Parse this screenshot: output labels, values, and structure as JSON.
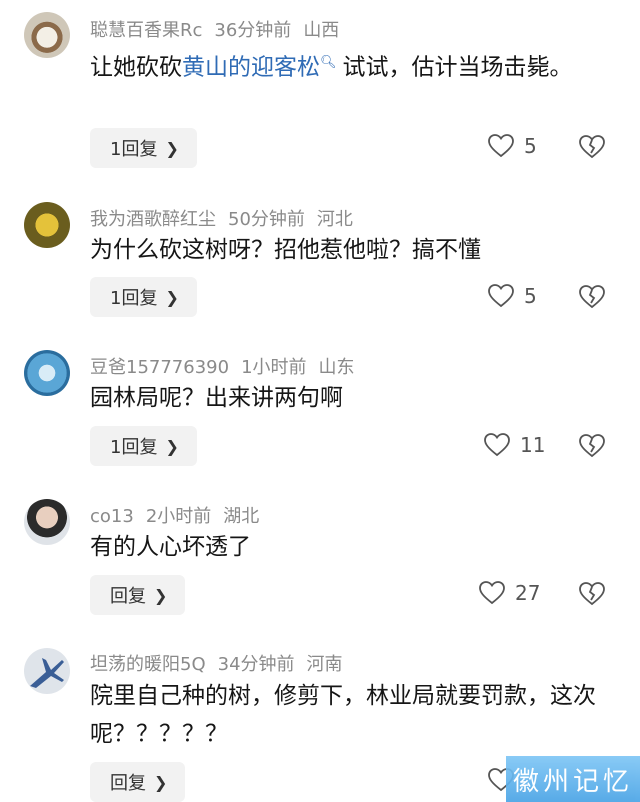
{
  "comments": [
    {
      "user": "聪慧百香果Rc",
      "time": "36分钟前",
      "location": "山西",
      "text_before": "让她砍砍",
      "link": "黄山的迎客松",
      "link_icon": "search-icon",
      "text_after": "试试，估计当场击毙。",
      "reply": "1回复",
      "likes": "5"
    },
    {
      "user": "我为酒歌醉红尘",
      "time": "50分钟前",
      "location": "河北",
      "text": "为什么砍这树呀？招他惹他啦？搞不懂",
      "reply": "1回复",
      "likes": "5"
    },
    {
      "user": "豆爸157776390",
      "time": "1小时前",
      "location": "山东",
      "text": "园林局呢？出来讲两句啊",
      "reply": "1回复",
      "likes": "11"
    },
    {
      "user": "co13",
      "time": "2小时前",
      "location": "湖北",
      "text": "有的人心坏透了",
      "reply": "回复",
      "likes": "27"
    },
    {
      "user": "坦荡的暖阳5Q",
      "time": "34分钟前",
      "location": "河南",
      "text": "院里自己种的树，修剪下，林业局就要罚款，这次呢？？？？？",
      "reply": "回复",
      "likes": ""
    }
  ],
  "watermark": "徽州记忆"
}
